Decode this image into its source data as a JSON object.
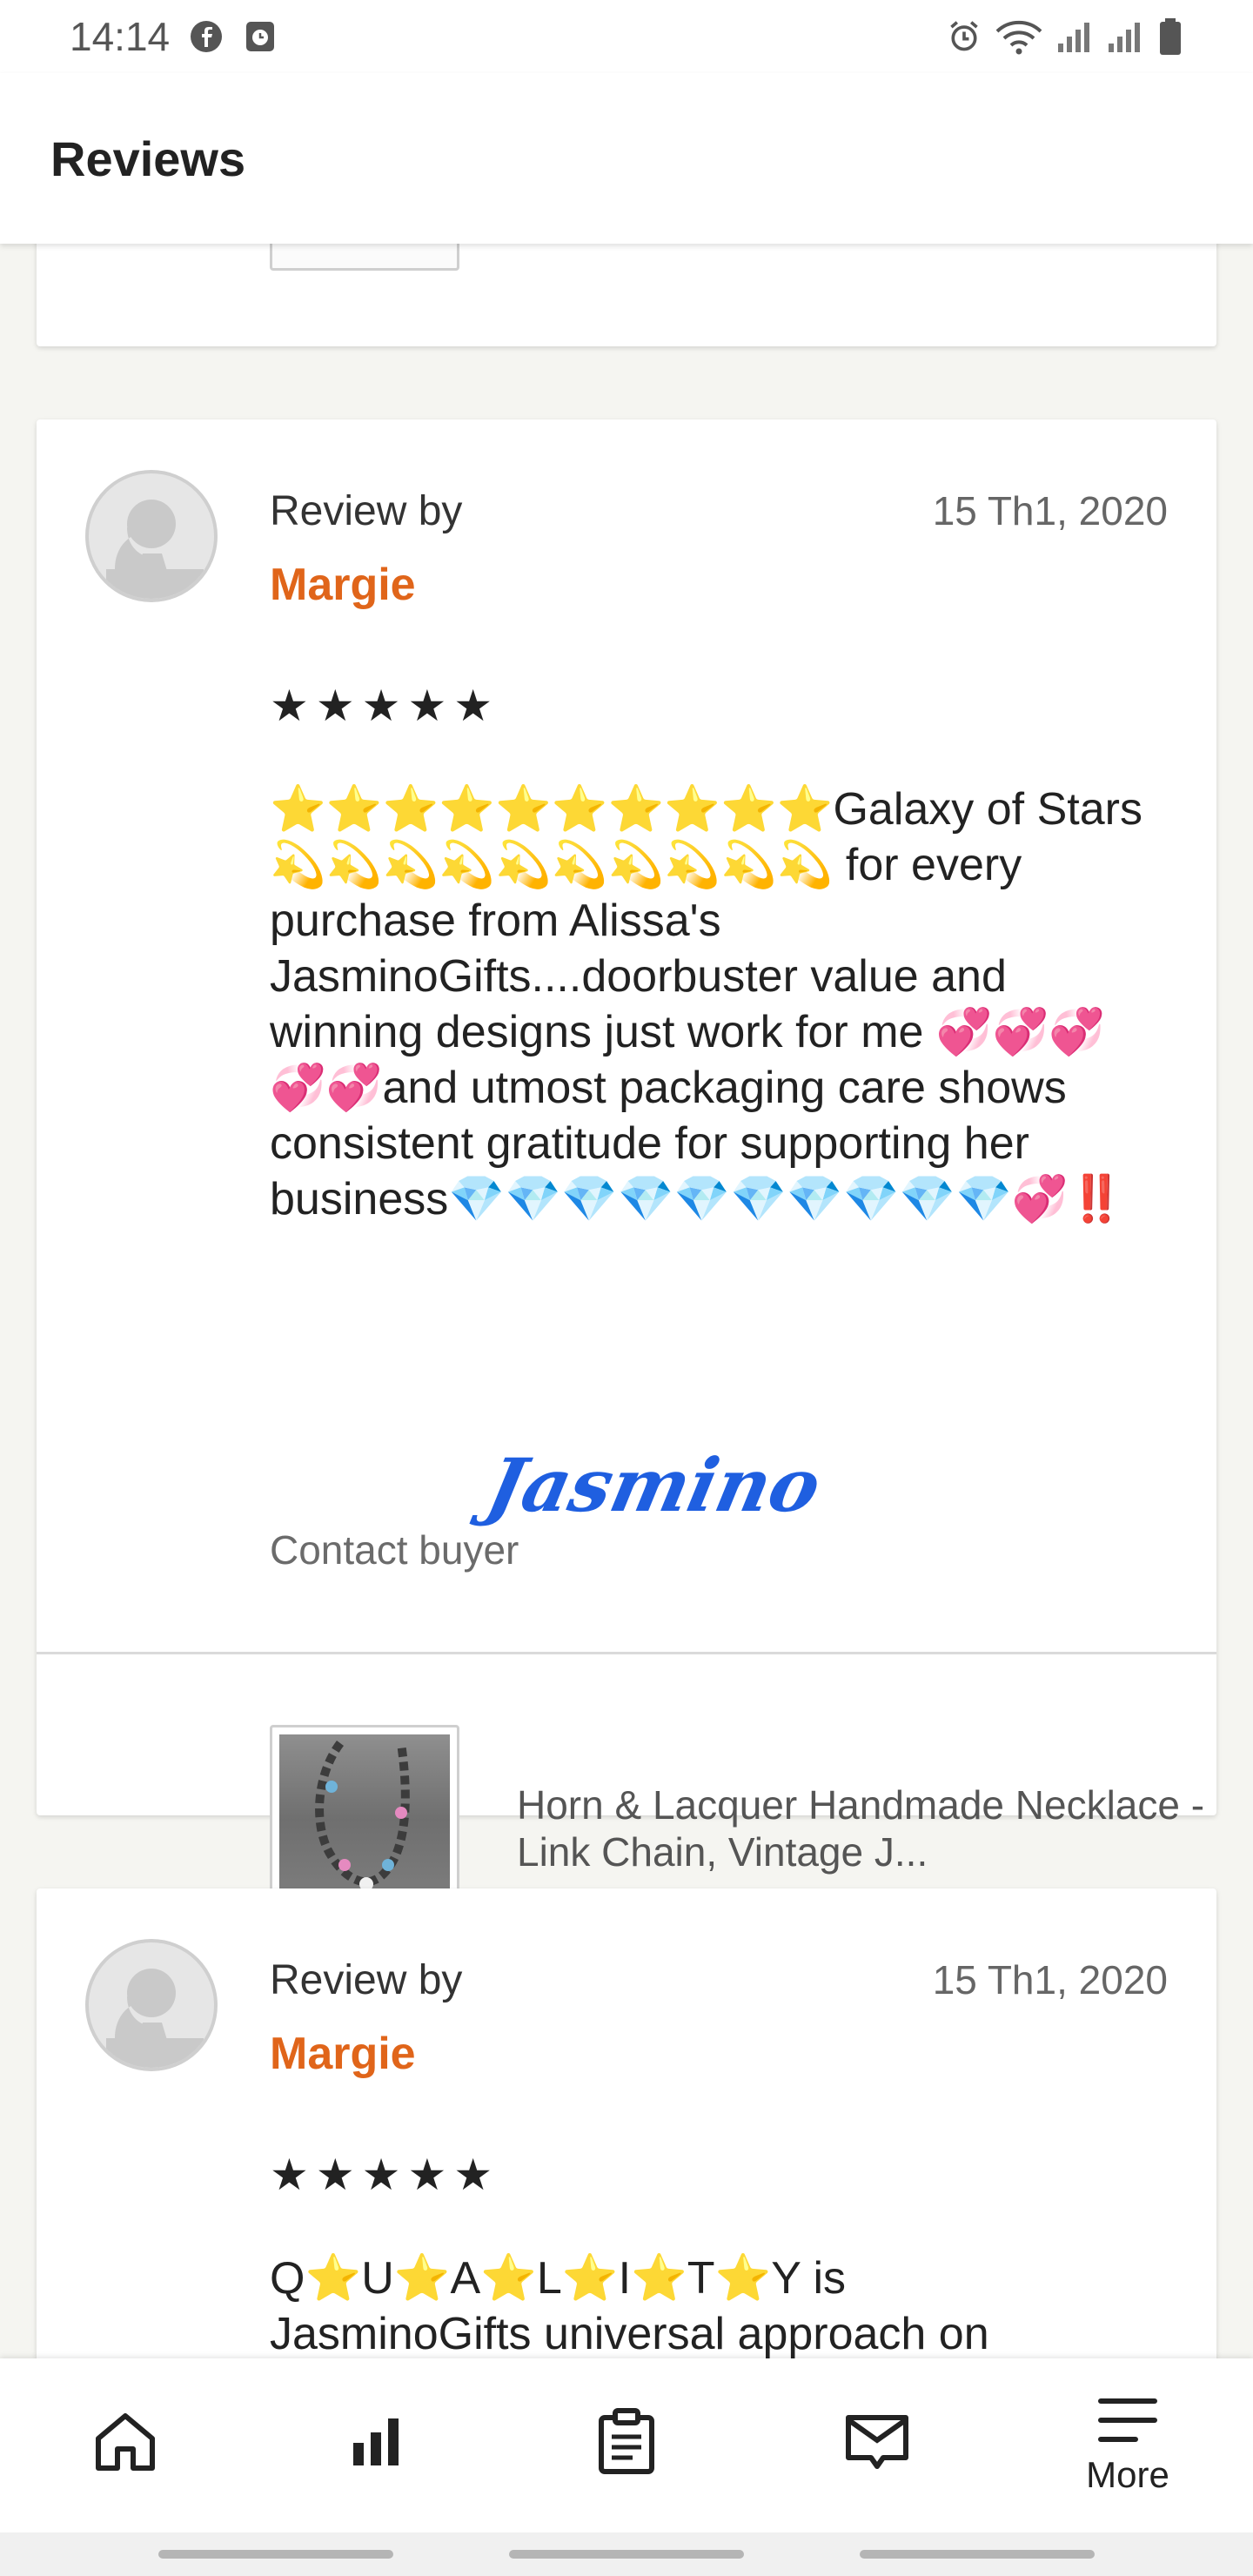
{
  "status_bar": {
    "time": "14:14",
    "left_icons": [
      "facebook-icon",
      "clock-app-icon"
    ],
    "right_icons": [
      "alarm-icon",
      "wifi-icon",
      "signal-icon",
      "signal-icon",
      "battery-icon"
    ]
  },
  "app_bar": {
    "title": "Reviews"
  },
  "reviews": [
    {
      "label": "Review by",
      "reviewer": "Margie",
      "date": "15 Th1, 2020",
      "stars": "★★★★★",
      "rating": 5,
      "text_seg": {
        "a": "⭐⭐⭐⭐⭐⭐⭐⭐⭐⭐",
        "b": "Galaxy of Stars",
        "c": "💫💫💫💫💫💫💫💫💫💫",
        "d": " for every purchase from Alissa's JasminoGifts....doorbuster value and winning designs just work for me ",
        "e": "💞💞💞💞💞",
        "f": "and utmost packaging care shows consistent gratitude for supporting her business",
        "g": "💎💎💎💎💎💎💎💎💎💎",
        "h": "💞",
        "i": "‼️"
      },
      "signature": "Jasmino",
      "contact": "Contact buyer",
      "product_title": "Horn & Lacquer Handmade Necklace - Link Chain, Vintage J..."
    },
    {
      "label": "Review by",
      "reviewer": "Margie",
      "date": "15 Th1, 2020",
      "stars": "★★★★★",
      "rating": 5,
      "text_seg": {
        "a": "Q⭐U⭐A⭐L⭐I⭐T⭐Y is",
        "b": "JasminoGifts universal approach on"
      }
    }
  ],
  "bottom_nav": {
    "items": [
      {
        "icon": "home-icon",
        "label": ""
      },
      {
        "icon": "stats-icon",
        "label": ""
      },
      {
        "icon": "orders-icon",
        "label": ""
      },
      {
        "icon": "messages-icon",
        "label": ""
      },
      {
        "icon": "menu-icon",
        "label": "More"
      }
    ]
  },
  "colors": {
    "reviewer": "#e0651a",
    "signature": "#1f5fe0",
    "background": "#f5f5f1"
  }
}
